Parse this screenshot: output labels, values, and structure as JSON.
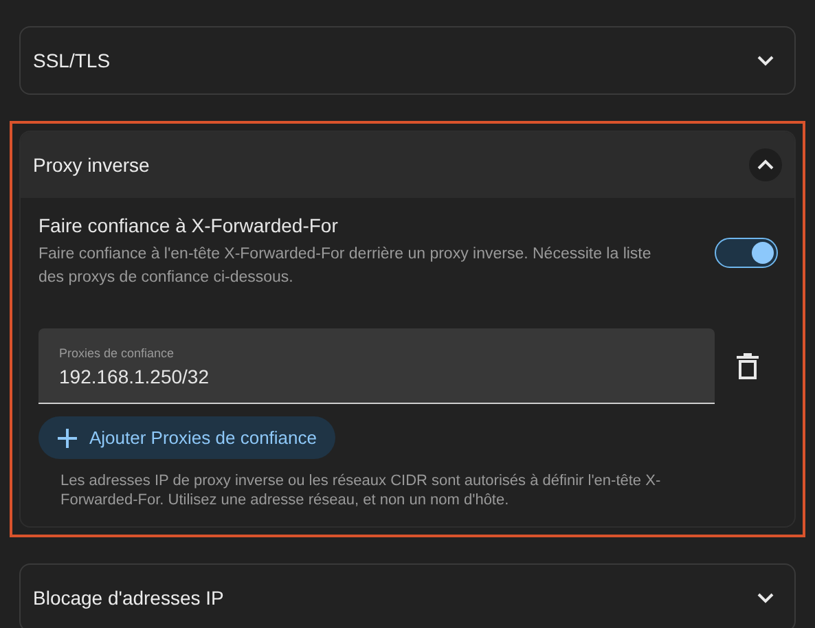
{
  "sections": [
    {
      "title": "SSL/TLS",
      "expanded": false,
      "highlighted": false
    },
    {
      "title": "Proxy inverse",
      "expanded": true,
      "highlighted": true,
      "setting": {
        "title": "Faire confiance à X-Forwarded-For",
        "description": "Faire confiance à l'en-tête X-Forwarded-For derrière un proxy inverse. Nécessite la liste des proxys de confiance ci-dessous.",
        "on": true
      },
      "proxies": [
        {
          "label": "Proxies de confiance",
          "value": "192.168.1.250/32"
        }
      ],
      "add_button": "Ajouter Proxies de confiance",
      "helper": "Les adresses IP de proxy inverse ou les réseaux CIDR sont autorisés à définir l'en-tête X-Forwarded-For. Utilisez une adresse réseau, et non un nom d'hôte."
    },
    {
      "title": "Blocage d'adresses IP",
      "expanded": false,
      "highlighted": false
    }
  ]
}
